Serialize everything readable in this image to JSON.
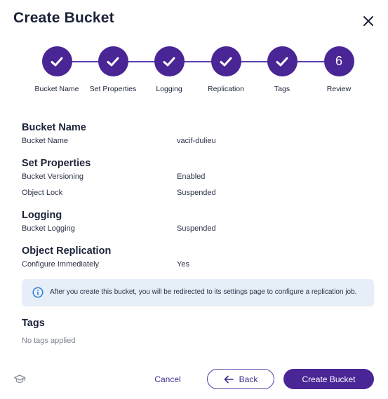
{
  "dialog": {
    "title": "Create Bucket"
  },
  "stepper": {
    "steps": [
      {
        "label": "Bucket Name",
        "status": "complete",
        "icon": "check-icon"
      },
      {
        "label": "Set Properties",
        "status": "complete",
        "icon": "check-icon"
      },
      {
        "label": "Logging",
        "status": "complete",
        "icon": "check-icon"
      },
      {
        "label": "Replication",
        "status": "complete",
        "icon": "check-icon"
      },
      {
        "label": "Tags",
        "status": "complete",
        "icon": "check-icon"
      },
      {
        "label": "Review",
        "status": "current",
        "number": "6"
      }
    ]
  },
  "review": {
    "bucket_name": {
      "title": "Bucket Name",
      "rows": [
        {
          "label": "Bucket Name",
          "value": "vacif-dulieu"
        }
      ]
    },
    "set_properties": {
      "title": "Set Properties",
      "rows": [
        {
          "label": "Bucket Versioning",
          "value": "Enabled"
        },
        {
          "label": "Object Lock",
          "value": "Suspended"
        }
      ]
    },
    "logging": {
      "title": "Logging",
      "rows": [
        {
          "label": "Bucket Logging",
          "value": "Suspended"
        }
      ]
    },
    "object_replication": {
      "title": "Object Replication",
      "rows": [
        {
          "label": "Configure Immediately",
          "value": "Yes"
        }
      ]
    },
    "info": {
      "icon": "info-icon",
      "text": "After you create this bucket, you will be redirected to its settings page to configure a replication job."
    },
    "tags": {
      "title": "Tags",
      "empty_text": "No tags applied"
    }
  },
  "footer": {
    "help_icon": "graduation-cap-icon",
    "cancel_label": "Cancel",
    "back_label": "Back",
    "create_label": "Create Bucket"
  },
  "colors": {
    "primary": "#4a2595",
    "text": "#1b2238",
    "info_bg": "#e6eef8",
    "info_icon": "#2f7fd1"
  }
}
